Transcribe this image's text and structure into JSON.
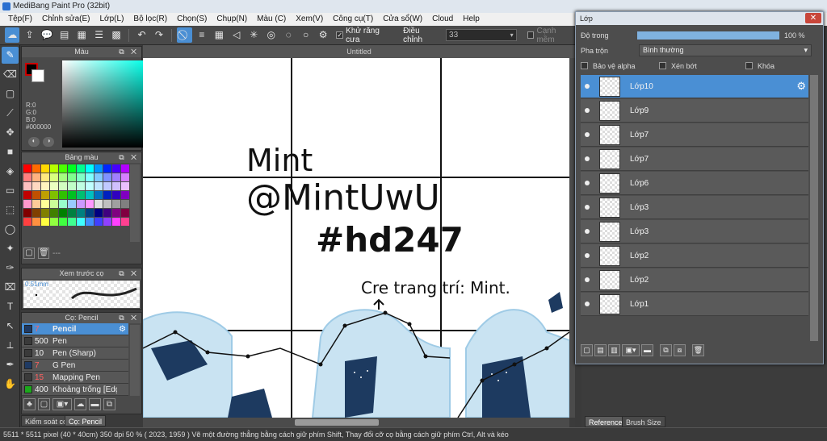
{
  "window": {
    "title": "MediBang Paint Pro (32bit)"
  },
  "menu": [
    "Tệp(F)",
    "Chỉnh sửa(E)",
    "Lớp(L)",
    "Bộ lọc(R)",
    "Chọn(S)",
    "Chụp(N)",
    "Màu (C)",
    "Xem(V)",
    "Công cụ(T)",
    "Cửa sổ(W)",
    "Cloud",
    "Help"
  ],
  "toolbar": {
    "antialias_label": "Khử răng cưa",
    "antialias_checked": true,
    "adjust_label": "Điều chỉnh",
    "adjust_value": "33",
    "edge_label": "Cạnh mềm",
    "edge_checked": false
  },
  "color_panel": {
    "title": "Màu",
    "r": "R:0",
    "g": "G:0",
    "b": "B:0",
    "hex": "#000000",
    "fg_color": "#000000",
    "bg_color": "#ffffff"
  },
  "palette_panel": {
    "title": "Bảng màu",
    "footer_text": "---"
  },
  "brush_preview": {
    "title": "Xem trước cọ",
    "size": "0.51mm"
  },
  "brush_panel": {
    "title": "Cọ: Pencil",
    "items": [
      {
        "size": "7",
        "name": "Pencil",
        "color": "#1f3a63",
        "selected": true
      },
      {
        "size": "500",
        "name": "Pen",
        "color": "#3a3a3a",
        "selected": false
      },
      {
        "size": "10",
        "name": "Pen (Sharp)",
        "color": "#3a3a3a",
        "selected": false
      },
      {
        "size": "7",
        "name": "G Pen",
        "color": "#1f3a63",
        "selected": false
      },
      {
        "size": "15",
        "name": "Mapping Pen",
        "color": "#3a3a3a",
        "selected": false
      },
      {
        "size": "400",
        "name": "Khoảng trống [Edge]",
        "color": "#1ca81c",
        "selected": false
      }
    ]
  },
  "bottom_tabs": {
    "left1": "Kiểm soát cọ",
    "left2": "Cọ: Pencil",
    "right1": "Reference",
    "right2": "Brush Size"
  },
  "document": {
    "tab": "Untitled",
    "text1": "Mint",
    "text2": "@MintUwU",
    "text3": "#hd247",
    "text4": "Cre trang trí: Mint."
  },
  "layer_panel": {
    "title": "Lớp",
    "opacity_label": "Độ trong",
    "opacity_value": "100 %",
    "opacity_fraction": 1.0,
    "blend_label": "Pha trộn",
    "blend_value": "Bình thường",
    "protect_alpha": "Bảo vệ alpha",
    "clipping": "Xén bớt",
    "lock": "Khóa",
    "layers": [
      {
        "name": "Lớp10",
        "selected": true
      },
      {
        "name": "Lớp9",
        "selected": false
      },
      {
        "name": "Lớp7",
        "selected": false
      },
      {
        "name": "Lớp7",
        "selected": false
      },
      {
        "name": "Lớp6",
        "selected": false
      },
      {
        "name": "Lớp3",
        "selected": false
      },
      {
        "name": "Lớp3",
        "selected": false
      },
      {
        "name": "Lớp2",
        "selected": false
      },
      {
        "name": "Lớp2",
        "selected": false
      },
      {
        "name": "Lớp1",
        "selected": false
      }
    ]
  },
  "status": {
    "text": "5511 * 5511 pixel  (40 * 40cm)  350 dpi  50 %  ( 2023, 1959 )  Vẽ một đường thẳng bằng cách giữ phím Shift, Thay đổi cỡ cọ bằng cách giữ phím Ctrl, Alt và kéo"
  },
  "colors": {
    "accent": "#4a8fd4",
    "panel": "#4a4a4a"
  },
  "swatches": [
    "#ff0000",
    "#ff6a00",
    "#ffd800",
    "#b6ff00",
    "#4cff00",
    "#00ff21",
    "#00ff90",
    "#00ffff",
    "#0094ff",
    "#0026ff",
    "#4800ff",
    "#b200ff",
    "#ff7f7f",
    "#ffb27f",
    "#ffe97f",
    "#daff7f",
    "#a5ff7f",
    "#7fff8e",
    "#7fffc5",
    "#7fffff",
    "#7fc9ff",
    "#7f92ff",
    "#a17fff",
    "#d67fff",
    "#ffc0c0",
    "#ffd8c0",
    "#fff4c0",
    "#ecffc0",
    "#d2ffc0",
    "#c0ffc7",
    "#c0ffe2",
    "#c0ffff",
    "#c0e4ff",
    "#c0c9ff",
    "#d0c0ff",
    "#eac0ff",
    "#c00000",
    "#c05000",
    "#c0a000",
    "#80c000",
    "#30c000",
    "#00c020",
    "#00c070",
    "#00c0c0",
    "#0070c0",
    "#0020c0",
    "#3000c0",
    "#8000c0",
    "#ff99cc",
    "#ffcc99",
    "#ffff99",
    "#ccff99",
    "#99ffcc",
    "#99ccff",
    "#cc99ff",
    "#ff99ff",
    "#e0e0e0",
    "#c0c0c0",
    "#a0a0a0",
    "#808080",
    "#800000",
    "#804000",
    "#808000",
    "#408000",
    "#008000",
    "#008040",
    "#008080",
    "#004080",
    "#000080",
    "#400080",
    "#800080",
    "#800040",
    "#ff4040",
    "#ff9040",
    "#ffff40",
    "#90ff40",
    "#40ff40",
    "#40ff90",
    "#40ffff",
    "#4090ff",
    "#4040ff",
    "#9040ff",
    "#ff40ff",
    "#ff4090"
  ]
}
